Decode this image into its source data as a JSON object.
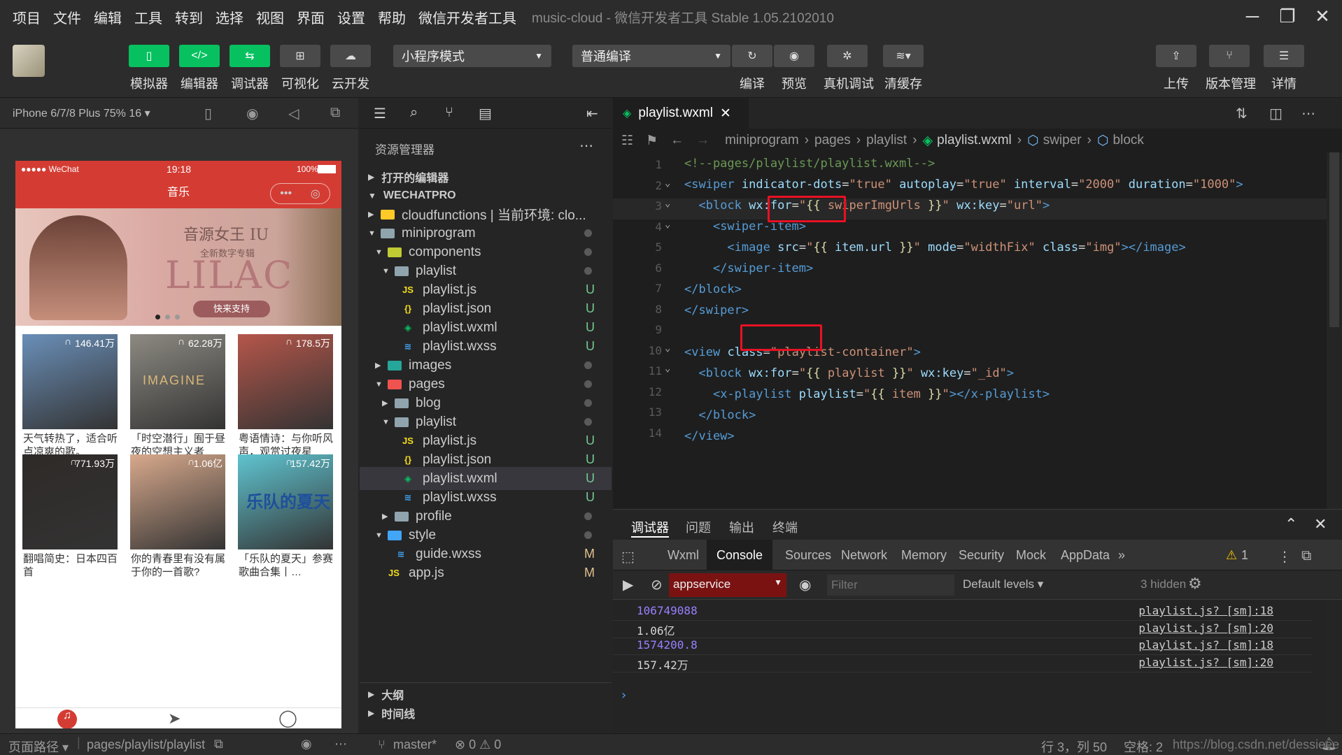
{
  "menu": [
    "项目",
    "文件",
    "编辑",
    "工具",
    "转到",
    "选择",
    "视图",
    "界面",
    "设置",
    "帮助",
    "微信开发者工具"
  ],
  "window_title": "music-cloud - 微信开发者工具 Stable 1.05.2102010",
  "toolbar": {
    "left": [
      {
        "label": "模拟器"
      },
      {
        "label": "编辑器"
      },
      {
        "label": "调试器"
      },
      {
        "label": "可视化"
      },
      {
        "label": "云开发"
      }
    ],
    "mode_select": "小程序模式",
    "compile_select": "普通编译",
    "right": [
      {
        "label": "编译"
      },
      {
        "label": "预览"
      },
      {
        "label": "真机调试"
      },
      {
        "label": "清缓存"
      }
    ],
    "far": [
      {
        "label": "上传"
      },
      {
        "label": "版本管理"
      },
      {
        "label": "详情"
      }
    ]
  },
  "simulator": {
    "device": "iPhone 6/7/8 Plus 75% 16 ▾",
    "status_carrier": "●●●●● WeChat",
    "status_time": "19:18",
    "status_battery": "100%",
    "nav_title": "音乐",
    "banner_title": "音源女王 IU",
    "banner_sub": "全新数字专辑",
    "banner_main": "LILAC",
    "banner_btn": "快来支持",
    "tiles": [
      {
        "count": "146.41万",
        "caption": "天气转热了，适合听点凉爽的歌。",
        "color": "#6a8fb8"
      },
      {
        "count": "62.28万",
        "caption": "「时空潜行」囿于昼夜的空想主义者",
        "color": "#8d8a82"
      },
      {
        "count": "178.5万",
        "caption": "粤语情诗：与你听风声，观赏过夜星",
        "color": "#b5564a"
      },
      {
        "count": "771.93万",
        "caption": "翻唱简史：日本四百首",
        "color": "#2e2a28"
      },
      {
        "count": "1.06亿",
        "caption": "你的青春里有没有属于你的一首歌?",
        "color": "#d8a98c"
      },
      {
        "count": "157.42万",
        "caption": "「乐队的夏天」参赛歌曲合集丨…",
        "color": "#5fc4d0"
      }
    ],
    "imagine_text": "IMAGINE",
    "tile6_text": "乐队的夏天"
  },
  "explorer": {
    "title": "资源管理器",
    "sections": {
      "open": "打开的编辑器",
      "project": "WECHATPRO",
      "outline": "大纲",
      "timeline": "时间线"
    },
    "rows": [
      {
        "label": "cloudfunctions | 当前环境: clo...",
        "icon": "folder",
        "indent": 1,
        "badge": ""
      },
      {
        "label": "miniprogram",
        "icon": "folder",
        "indent": 1,
        "badge": "dot"
      },
      {
        "label": "components",
        "icon": "folder",
        "indent": 2,
        "badge": "dot"
      },
      {
        "label": "playlist",
        "icon": "folder",
        "indent": 3,
        "badge": "dot"
      },
      {
        "label": "playlist.js",
        "icon": "js",
        "indent": 4,
        "badge": "U"
      },
      {
        "label": "playlist.json",
        "icon": "json",
        "indent": 4,
        "badge": "U"
      },
      {
        "label": "playlist.wxml",
        "icon": "wxml",
        "indent": 4,
        "badge": "U"
      },
      {
        "label": "playlist.wxss",
        "icon": "wxss",
        "indent": 4,
        "badge": "U"
      },
      {
        "label": "images",
        "icon": "folder",
        "indent": 2,
        "badge": "dot"
      },
      {
        "label": "pages",
        "icon": "folder",
        "indent": 2,
        "badge": "dot"
      },
      {
        "label": "blog",
        "icon": "folder",
        "indent": 3,
        "badge": "dot"
      },
      {
        "label": "playlist",
        "icon": "folder",
        "indent": 3,
        "badge": "dot"
      },
      {
        "label": "playlist.js",
        "icon": "js",
        "indent": 4,
        "badge": "U"
      },
      {
        "label": "playlist.json",
        "icon": "json",
        "indent": 4,
        "badge": "U"
      },
      {
        "label": "playlist.wxml",
        "icon": "wxml",
        "indent": 4,
        "badge": "U"
      },
      {
        "label": "playlist.wxss",
        "icon": "wxss",
        "indent": 4,
        "badge": "U"
      },
      {
        "label": "profile",
        "icon": "folder",
        "indent": 3,
        "badge": "dot"
      },
      {
        "label": "style",
        "icon": "folder",
        "indent": 2,
        "badge": "dot"
      },
      {
        "label": "guide.wxss",
        "icon": "wxss",
        "indent": 3,
        "badge": "M"
      },
      {
        "label": "app.js",
        "icon": "js",
        "indent": 2,
        "badge": "M"
      }
    ]
  },
  "editor": {
    "tab": "playlist.wxml",
    "breadcrumb": [
      "miniprogram",
      "pages",
      "playlist",
      "playlist.wxml",
      "swiper",
      "block"
    ],
    "lines": [
      "1",
      "2",
      "3",
      "4",
      "5",
      "6",
      "7",
      "8",
      "9",
      "10",
      "11",
      "12",
      "13",
      "14"
    ]
  },
  "devtools": {
    "top_tabs": [
      "调试器",
      "问题",
      "输出",
      "终端"
    ],
    "tabs": [
      "Wxml",
      "Console",
      "Sources",
      "Network",
      "Memory",
      "Security",
      "Mock",
      "AppData"
    ],
    "more": "»",
    "warnings": "1",
    "context": "appservice",
    "filter_placeholder": "Filter",
    "levels": "Default levels ▾",
    "hidden": "3 hidden",
    "logs": [
      {
        "value": "106749088",
        "source": "playlist.js? [sm]:18",
        "color": "#9980ff"
      },
      {
        "value": "1.06亿",
        "source": "playlist.js? [sm]:20",
        "color": "#d4d4d4"
      },
      {
        "value": "1574200.8",
        "source": "playlist.js? [sm]:18",
        "color": "#9980ff"
      },
      {
        "value": "157.42万",
        "source": "playlist.js? [sm]:20",
        "color": "#d4d4d4"
      }
    ],
    "prompt": "›"
  },
  "statusbar": {
    "page_path_label": "页面路径 ▾",
    "page_path": "pages/playlist/playlist",
    "branch": "master*",
    "errors": "⊗ 0 ⚠ 0",
    "cursor": "行 3，列 50",
    "spaces": "空格: 2",
    "watermark": "https://blog.csdn.net/dessieee"
  }
}
